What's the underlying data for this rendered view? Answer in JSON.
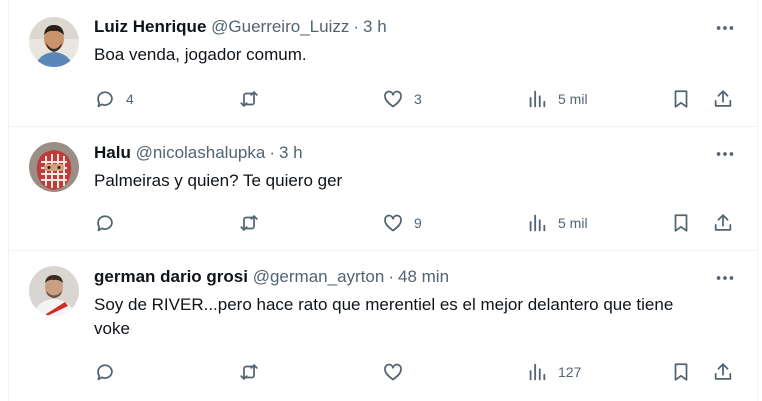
{
  "tweets": [
    {
      "name": "Luiz Henrique",
      "handle": "@Guerreiro_Luizz",
      "time": "3 h",
      "text": "Boa venda, jogador comum.",
      "replies": "4",
      "retweets": "",
      "likes": "3",
      "views": "5 mil"
    },
    {
      "name": "Halu",
      "handle": "@nicolashalupka",
      "time": "3 h",
      "text": "Palmeiras y quien? Te quiero ger",
      "replies": "",
      "retweets": "",
      "likes": "9",
      "views": "5 mil"
    },
    {
      "name": "german dario grosi",
      "handle": "@german_ayrton",
      "time": "48 min",
      "text": "Soy de RIVER...pero hace rato que merentiel es el mejor delantero que tiene voke",
      "replies": "",
      "retweets": "",
      "likes": "",
      "views": "127"
    }
  ],
  "separator": "·",
  "icons": [
    "more-icon",
    "reply-icon",
    "retweet-icon",
    "like-icon",
    "views-icon",
    "bookmark-icon",
    "share-icon"
  ],
  "colors": {
    "text": "#0f1419",
    "secondary": "#536471",
    "border": "#eff3f4"
  }
}
